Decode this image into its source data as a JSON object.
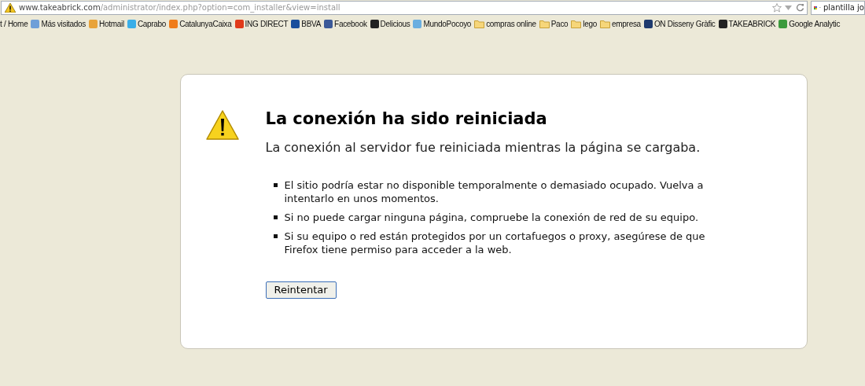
{
  "address_bar": {
    "host": "www.takeabrick.com",
    "path": "/administrator/index.php?option=com_installer&view=install"
  },
  "search_box": {
    "value": "plantilla jo"
  },
  "bookmarks": [
    {
      "kind": "text",
      "label": "t / Home"
    },
    {
      "kind": "site",
      "label": "Más visitados",
      "color": "#6f9fd8"
    },
    {
      "kind": "site",
      "label": "Hotmail",
      "color": "#e8a33a"
    },
    {
      "kind": "site",
      "label": "Caprabo",
      "color": "#3aaee8"
    },
    {
      "kind": "site",
      "label": "CatalunyaCaixa",
      "color": "#f07c1a"
    },
    {
      "kind": "site",
      "label": "ING DIRECT",
      "color": "#e03a1a"
    },
    {
      "kind": "site",
      "label": "BBVA",
      "color": "#1a4f9c"
    },
    {
      "kind": "site",
      "label": "Facebook",
      "color": "#3b5998"
    },
    {
      "kind": "site",
      "label": "Delicious",
      "color": "#222222"
    },
    {
      "kind": "site",
      "label": "MundoPocoyo",
      "color": "#6aaee0"
    },
    {
      "kind": "folder",
      "label": "compras online"
    },
    {
      "kind": "folder",
      "label": "Paco"
    },
    {
      "kind": "folder",
      "label": "lego"
    },
    {
      "kind": "folder",
      "label": "empresa"
    },
    {
      "kind": "site",
      "label": "ON Disseny Gràfic",
      "color": "#1e3a6e"
    },
    {
      "kind": "site",
      "label": "TAKEABRICK",
      "color": "#222222"
    },
    {
      "kind": "site",
      "label": "Google Analytic",
      "color": "#3c9a3c"
    }
  ],
  "error_page": {
    "title": "La conexión ha sido reiniciada",
    "subtitle": "La conexión al servidor fue reiniciada mientras la página se cargaba.",
    "bullets": [
      "El sitio podría estar no disponible temporalmente o demasiado ocupado. Vuelva a intentarlo en unos momentos.",
      "Si no puede cargar ninguna página, compruebe la conexión de red de su equipo.",
      "Si su equipo o red están protegidos por un cortafuegos o proxy, asegúrese de que Firefox tiene permiso para acceder a la web."
    ],
    "button": "Reintentar"
  }
}
